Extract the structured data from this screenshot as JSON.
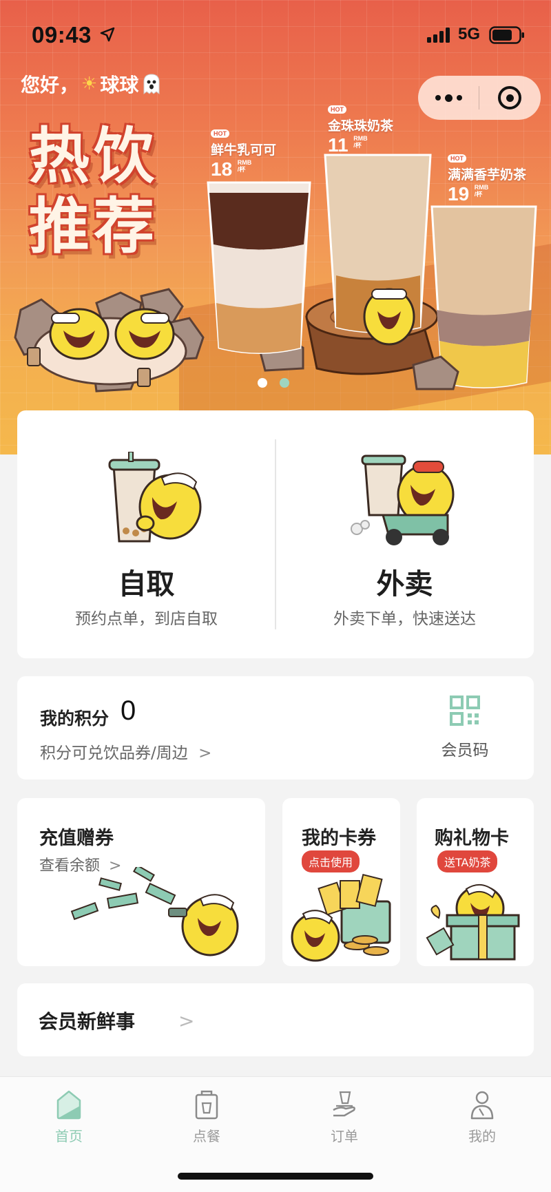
{
  "status_bar": {
    "time": "09:43",
    "network": "5G"
  },
  "greeting": {
    "prefix": "您好，",
    "name": "球球"
  },
  "banner": {
    "title_line1": "热饮",
    "title_line2": "推荐",
    "drinks": [
      {
        "badge": "HOT",
        "name": "鲜牛乳可可",
        "price": "18",
        "unit_top": "RMB",
        "unit_bottom": "/杯"
      },
      {
        "badge": "HOT",
        "name": "金珠珠奶茶",
        "price": "11",
        "unit_top": "RMB",
        "unit_bottom": "/杯"
      },
      {
        "badge": "HOT",
        "name": "满满香芋奶茶",
        "price": "19",
        "unit_top": "RMB",
        "unit_bottom": "/杯"
      }
    ],
    "page_indicator": {
      "count": 2,
      "active": 1
    }
  },
  "order": {
    "pickup": {
      "title": "自取",
      "subtitle": "预约点单，到店自取"
    },
    "delivery": {
      "title": "外卖",
      "subtitle": "外卖下单，快速送达"
    }
  },
  "points": {
    "label": "我的积分",
    "value": "0",
    "subtitle": "积分可兑饮品券/周边",
    "chevron": ">",
    "member_code_label": "会员码"
  },
  "recharge": {
    "title": "充值赠券",
    "subtitle": "查看余额",
    "chevron": ">"
  },
  "my_coupons": {
    "title": "我的卡券",
    "tag": "点击使用"
  },
  "gift_card": {
    "title": "购礼物卡",
    "tag": "送TA奶茶"
  },
  "news": {
    "title": "会员新鲜事",
    "chevron": ">"
  },
  "tabbar": {
    "items": [
      {
        "label": "首页",
        "icon": "home-icon",
        "active": true
      },
      {
        "label": "点餐",
        "icon": "order-bag-icon",
        "active": false
      },
      {
        "label": "订单",
        "icon": "orders-hand-icon",
        "active": false
      },
      {
        "label": "我的",
        "icon": "profile-icon",
        "active": false
      }
    ]
  },
  "colors": {
    "accent_green": "#8dcbb3",
    "tag_red": "#e0473d",
    "banner_orange": "#ee7a4f"
  }
}
